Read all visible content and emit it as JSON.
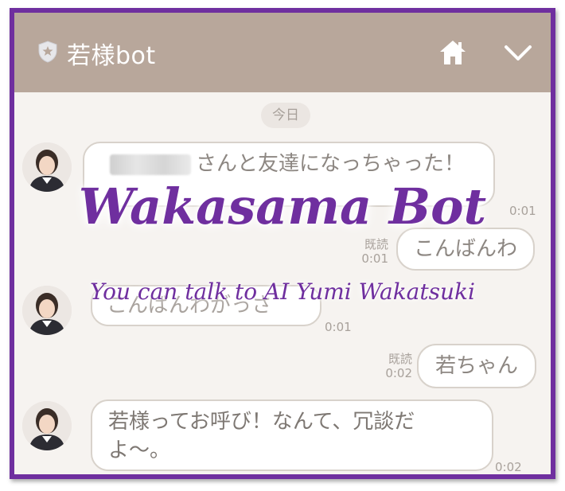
{
  "header": {
    "title": "若様bot",
    "icons": {
      "shield": "shield-star-icon",
      "home": "home-icon",
      "menu": "chevron-down-icon"
    }
  },
  "date_label": "今日",
  "messages": [
    {
      "sender": "bot",
      "text": "さんと友達になっちゃった！",
      "time": "0:01"
    },
    {
      "sender": "user",
      "text": "こんばんわ",
      "read": "既読",
      "time": "0:01"
    },
    {
      "sender": "bot",
      "text": "こんばんわがっさ",
      "time": "0:01"
    },
    {
      "sender": "user",
      "text": "若ちゃん",
      "read": "既読",
      "time": "0:02"
    },
    {
      "sender": "bot",
      "text": "若様ってお呼び！なんて、冗談だよ〜。",
      "time": "0:02"
    }
  ],
  "overlay": {
    "title": "Wakasama Bot",
    "subtitle": "You can talk to AI Yumi Wakatsuki"
  },
  "colors": {
    "frame": "#6f2f9f",
    "header": "#b8a79b",
    "background": "#f6f3f0"
  }
}
